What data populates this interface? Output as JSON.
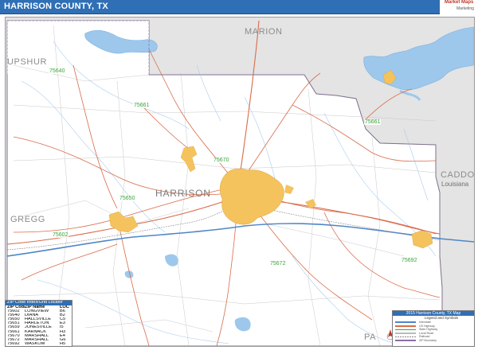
{
  "header": {
    "title": "HARRISON COUNTY, TX",
    "logo_text": "Market Maps",
    "logo_sub": "Marketing"
  },
  "colors": {
    "header_bg": "#2f6fb5",
    "county_fill": "#ffffff",
    "outside_fill": "#e4e4e4",
    "water": "#9dc8ec",
    "city_fill": "#f4c35e",
    "zip_label": "#3aa43a",
    "highway_blue": "#4f86c6",
    "road_red": "#d96b4a"
  },
  "map": {
    "county_name": "HARRISON",
    "neighbor_counties": [
      "MARION",
      "UPSHUR",
      "CADDO",
      "GREGG",
      "PA"
    ],
    "state_label": "Louisiana",
    "zip_labels": [
      "75640",
      "75661",
      "75661",
      "75670",
      "75650",
      "75602",
      "75672",
      "75692"
    ]
  },
  "zip_table": {
    "title": "ZIP Code Index/Grid Locator",
    "columns": [
      "ZIP Code",
      "ZIP Name",
      "LOC"
    ],
    "rows": [
      [
        "75602",
        "LONGVIEW",
        "B6"
      ],
      [
        "75640",
        "DIANA",
        "B2"
      ],
      [
        "75650",
        "HALLSVILLE",
        "C5"
      ],
      [
        "75651",
        "HARLETON",
        "E3"
      ],
      [
        "75659",
        "JONESVILLE",
        "I5"
      ],
      [
        "75661",
        "KARNACK",
        "H3"
      ],
      [
        "75670",
        "MARSHALL",
        "E4"
      ],
      [
        "75672",
        "MARSHALL",
        "G6"
      ],
      [
        "75692",
        "WASKOM",
        "H5"
      ]
    ]
  },
  "legend": {
    "title": "2015 Harrison County, TX Map",
    "subtitle": "Legend and Symbols",
    "items": [
      "Interstate",
      "US Highway",
      "State Highway",
      "Local Road",
      "Railroad",
      "ZIP Boundary"
    ]
  }
}
